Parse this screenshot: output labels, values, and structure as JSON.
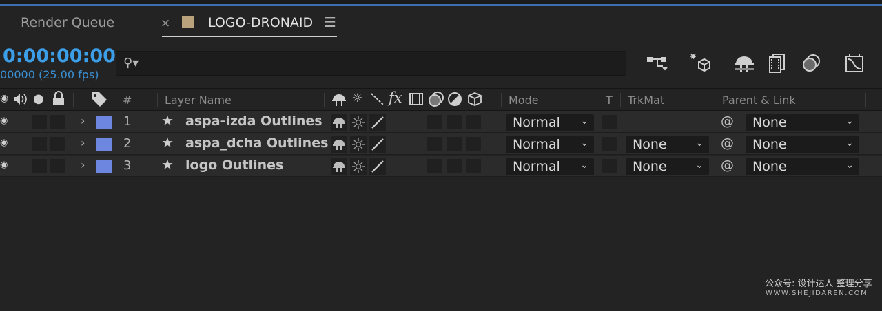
{
  "tabs": {
    "render_queue": "Render Queue",
    "close_glyph": "×",
    "active_comp": "LOGO-DRONAID",
    "menu_glyph": "☰"
  },
  "time": {
    "timecode": "0:00:00:00",
    "frame_fps": "00000 (25.00 fps)"
  },
  "search": {
    "icon_glyph": "⚲▾",
    "value": "",
    "placeholder": ""
  },
  "columns": {
    "number": "#",
    "layer_name": "Layer Name",
    "fx": "fx",
    "mode": "Mode",
    "t": "T",
    "trkmat": "TrkMat",
    "parent_link": "Parent & Link"
  },
  "layers": [
    {
      "num": "1",
      "name": "aspa-izda Outlines",
      "mode": "Normal",
      "trkmat": "",
      "parent": "None"
    },
    {
      "num": "2",
      "name": "aspa_dcha Outlines",
      "mode": "Normal",
      "trkmat": "None",
      "parent": "None"
    },
    {
      "num": "3",
      "name": "logo Outlines",
      "mode": "Normal",
      "trkmat": "None",
      "parent": "None"
    }
  ],
  "glyphs": {
    "eye": "◉",
    "chevron": "›",
    "star": "★",
    "caret": "⌄",
    "pickwhip": "@"
  },
  "colors": {
    "accent_blue": "#3d9ee8",
    "comp_swatch": "#b9a27c",
    "layer_label": "#6d86e0"
  },
  "watermark": {
    "line1": "公众号: 设计达人 整理分享",
    "line2": "WWW.SHEJIDAREN.COM"
  }
}
